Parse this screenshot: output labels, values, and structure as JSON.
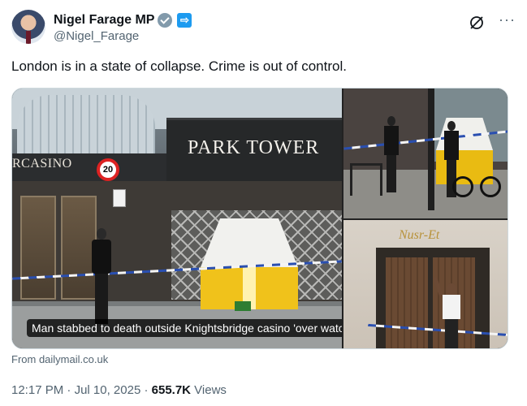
{
  "author": {
    "display_name": "Nigel Farage MP",
    "handle": "@Nigel_Farage",
    "verified_badge": "verified-icon",
    "affiliate_badge": "⇨",
    "avatar_icon": "avatar"
  },
  "header_actions": {
    "grok_icon": "grok-icon",
    "more_icon": "···"
  },
  "tweet": {
    "text": "London is in a state of collapse. Crime is out of control."
  },
  "media": {
    "main_photo": {
      "casino_sign": "RCASINO",
      "park_sign": "PARK TOWER",
      "speed_limit": "20",
      "caption": "Man stabbed to death outside Knightsbridge casino 'over watch'"
    },
    "side_bottom_photo": {
      "shop_sign": "Nusr-Et"
    }
  },
  "card_source": "From dailymail.co.uk",
  "meta": {
    "time": "12:17 PM",
    "separator": " · ",
    "date": "Jul 10, 2025",
    "separator2": " · ",
    "views_count": "655.7K",
    "views_label": " Views"
  },
  "colors": {
    "text_primary": "#0f1419",
    "text_secondary": "#536471",
    "verified_badge": "#829aab",
    "affiliate_badge": "#1d9bf0"
  }
}
